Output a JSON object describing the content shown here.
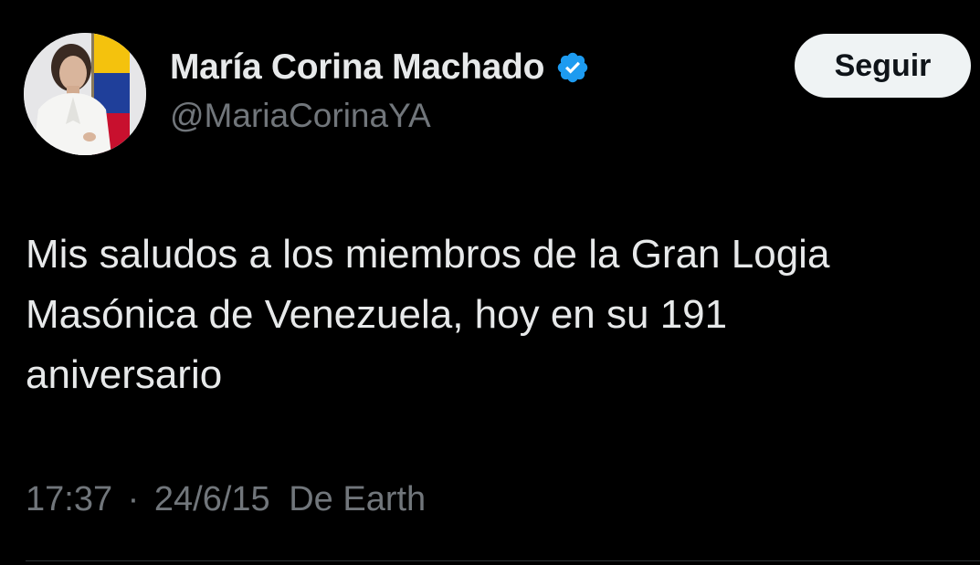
{
  "author": {
    "display_name": "María Corina Machado",
    "handle": "@MariaCorinaYA",
    "verified": true,
    "verified_color": "#1d9bf0"
  },
  "follow_button": {
    "label": "Seguir"
  },
  "tweet": {
    "line1": "Mis saludos a los miembros de la Gran Logia",
    "line2": "Masónica de Venezuela, hoy en su 191",
    "line3": "aniversario"
  },
  "meta": {
    "time": "17:37",
    "separator": "·",
    "date": "24/6/15",
    "source": "De Earth"
  },
  "colors": {
    "background": "#000000",
    "text_primary": "#e7e9ea",
    "text_secondary": "#71767b",
    "button_bg": "#eff3f4"
  }
}
